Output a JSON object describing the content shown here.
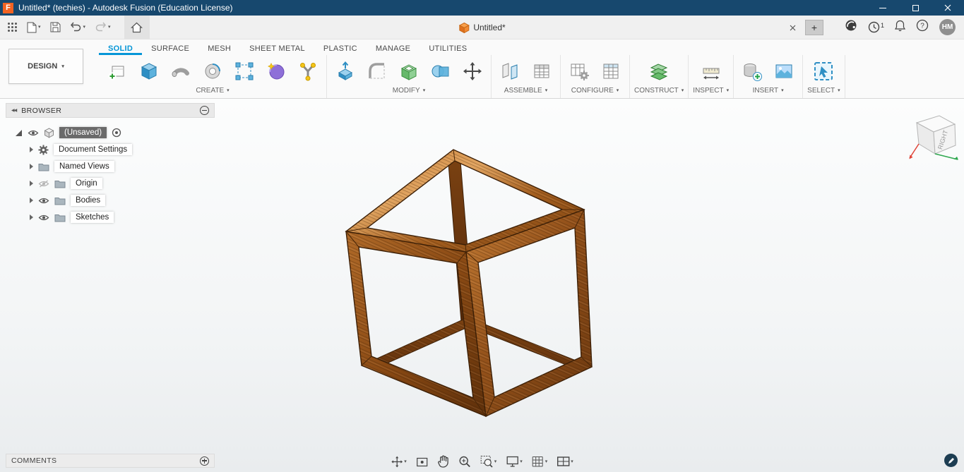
{
  "title_bar": {
    "title": "Untitled* (techies) - Autodesk Fusion (Education License)"
  },
  "app_bar": {
    "doc_tab_label": "Untitled*",
    "notification_count": "1",
    "avatar_initials": "HM"
  },
  "ribbon": {
    "design_label": "DESIGN",
    "tabs": [
      {
        "label": "SOLID",
        "active": true
      },
      {
        "label": "SURFACE",
        "active": false
      },
      {
        "label": "MESH",
        "active": false
      },
      {
        "label": "SHEET METAL",
        "active": false
      },
      {
        "label": "PLASTIC",
        "active": false
      },
      {
        "label": "MANAGE",
        "active": false
      },
      {
        "label": "UTILITIES",
        "active": false
      }
    ],
    "groups": [
      {
        "label": "CREATE"
      },
      {
        "label": "MODIFY"
      },
      {
        "label": "ASSEMBLE"
      },
      {
        "label": "CONFIGURE"
      },
      {
        "label": "CONSTRUCT"
      },
      {
        "label": "INSPECT"
      },
      {
        "label": "INSERT"
      },
      {
        "label": "SELECT"
      }
    ]
  },
  "browser": {
    "header_label": "BROWSER",
    "root_label": "(Unsaved)",
    "items": [
      {
        "label": "Document Settings"
      },
      {
        "label": "Named Views"
      },
      {
        "label": "Origin"
      },
      {
        "label": "Bodies"
      },
      {
        "label": "Sketches"
      }
    ]
  },
  "viewcube": {
    "face_label": "RIGHT"
  },
  "comments_panel": {
    "label": "COMMENTS"
  },
  "icons": {
    "help_glyph": "?"
  },
  "colors": {
    "accent_blue": "#0696d7",
    "title_bar_blue": "#17486e",
    "wood_light": "#e0a35f",
    "wood_dark": "#5f300a"
  }
}
